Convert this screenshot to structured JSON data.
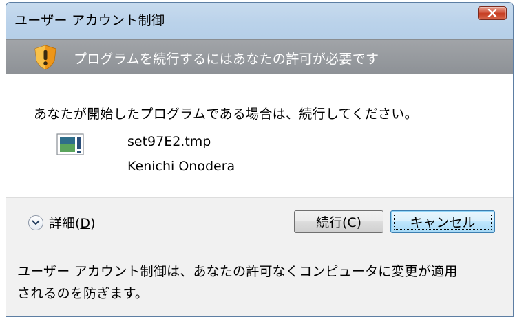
{
  "window": {
    "title": "ユーザー アカウント制御",
    "close_label": "×"
  },
  "banner": {
    "text": "プログラムを続行するにはあなたの許可が必要です",
    "icon": "uac-shield-icon"
  },
  "content": {
    "prompt": "あなたが開始したプログラムである場合は、続行してください。",
    "file_name": "set97E2.tmp",
    "publisher": "Kenichi Onodera",
    "file_icon": "program-file-icon"
  },
  "actions": {
    "details_label": "詳細(",
    "details_accel": "D",
    "details_suffix": ")",
    "continue_label": "続行(",
    "continue_accel": "C",
    "continue_suffix": ")",
    "cancel_label": "キャンセル"
  },
  "footer": {
    "text_line1": "ユーザー アカウント制御は、あなたの許可なくコンピュータに変更が適用",
    "text_line2": "されるのを防ぎます。"
  },
  "colors": {
    "banner_bg": "#9a9da1",
    "close_button": "#c53a1f",
    "default_button_border": "#3c7fb1"
  }
}
